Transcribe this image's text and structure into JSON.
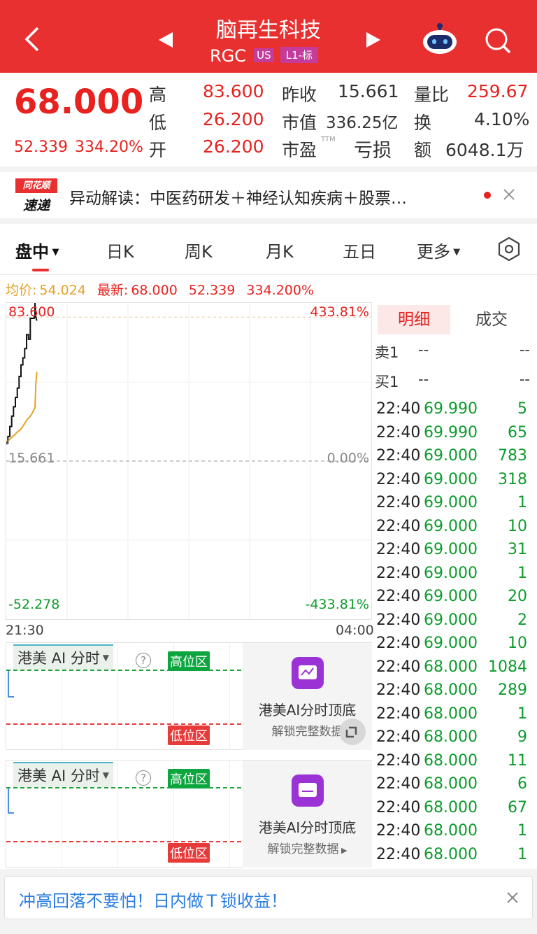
{
  "header": {
    "title": "脑再生科技",
    "ticker": "RGC",
    "market_badge": "US",
    "level_badge": "L1-标"
  },
  "quote": {
    "price": "68.000",
    "change": "52.339",
    "change_pct": "334.20%",
    "fields": [
      {
        "label": "高",
        "value": "83.600",
        "label2": "昨收",
        "value2": "15.661",
        "label3": "量比",
        "value3": "259.67"
      },
      {
        "label": "低",
        "value": "26.200",
        "label2": "市值",
        "value2": "336.25亿",
        "label3": "换",
        "value3": "4.10%"
      },
      {
        "label": "开",
        "value": "26.200",
        "label2": "市盈",
        "value2": "亏损",
        "label3": "额",
        "value3": "6048.1万"
      }
    ],
    "pe_suffix": "TTM"
  },
  "alert": {
    "logo_top": "同花顺",
    "logo_bottom": "速递",
    "text": "异动解读：中医药研发＋神经认知疾病＋股票…"
  },
  "tabs": [
    "盘中",
    "日K",
    "周K",
    "月K",
    "五日",
    "更多"
  ],
  "summary": {
    "avg_label": "均价:",
    "avg_value": "54.024",
    "latest_label": "最新:",
    "latest_value": "68.000",
    "change": "52.339",
    "change_pct": "334.200%"
  },
  "chart": {
    "y_max": "83.600",
    "y_mid": "15.661",
    "y_min": "-52.278",
    "pct_max": "433.81%",
    "pct_mid": "0.00%",
    "pct_min": "-433.81%",
    "t_start": "21:30",
    "t_end": "04:00"
  },
  "chart_data": {
    "type": "line",
    "x_range": [
      "21:30",
      "04:00"
    ],
    "ylim": [
      -52.278,
      83.6
    ],
    "reference": 15.661,
    "series": [
      {
        "name": "最新",
        "color": "#111111",
        "points": [
          [
            0,
            23.5
          ],
          [
            1,
            23.5
          ],
          [
            1,
            26.2
          ],
          [
            3,
            26.2
          ],
          [
            3,
            30.5
          ],
          [
            5,
            30.5
          ],
          [
            5,
            35
          ],
          [
            7,
            35
          ],
          [
            7,
            39
          ],
          [
            9,
            39
          ],
          [
            9,
            43
          ],
          [
            11,
            43
          ],
          [
            11,
            47
          ],
          [
            13,
            47
          ],
          [
            13,
            52
          ],
          [
            15,
            52
          ],
          [
            15,
            57
          ],
          [
            17,
            57
          ],
          [
            17,
            60
          ],
          [
            19,
            60
          ],
          [
            19,
            64
          ],
          [
            21,
            64
          ],
          [
            21,
            70
          ],
          [
            23,
            70
          ],
          [
            23,
            68
          ],
          [
            25,
            68
          ],
          [
            25,
            77
          ],
          [
            29,
            77
          ],
          [
            29,
            77.5
          ],
          [
            30,
            77.5
          ],
          [
            30,
            83.6
          ],
          [
            31,
            77.5
          ],
          [
            32,
            76
          ]
        ]
      },
      {
        "name": "均价",
        "color": "#e5a128",
        "points": [
          [
            0,
            23.5
          ],
          [
            1,
            24
          ],
          [
            2,
            24.6
          ],
          [
            4,
            25.5
          ],
          [
            6,
            26.2
          ],
          [
            8,
            26.8
          ],
          [
            10,
            27.7
          ],
          [
            12,
            28.5
          ],
          [
            14,
            29
          ],
          [
            16,
            30
          ],
          [
            18,
            31.2
          ],
          [
            20,
            32.5
          ],
          [
            22,
            33.7
          ],
          [
            24,
            34.5
          ],
          [
            26,
            35.5
          ],
          [
            28,
            37
          ],
          [
            30,
            38.5
          ],
          [
            31,
            49
          ],
          [
            32,
            54.024
          ]
        ]
      }
    ]
  },
  "detail": {
    "tab_active": "明细",
    "tab_other": "成交",
    "sell": "卖1",
    "buy": "买1",
    "dash": "--",
    "rows": [
      [
        "22:40",
        "69.990",
        "5"
      ],
      [
        "22:40",
        "69.990",
        "65"
      ],
      [
        "22:40",
        "69.000",
        "783"
      ],
      [
        "22:40",
        "69.000",
        "318"
      ],
      [
        "22:40",
        "69.000",
        "1"
      ],
      [
        "22:40",
        "69.000",
        "10"
      ],
      [
        "22:40",
        "69.000",
        "31"
      ],
      [
        "22:40",
        "69.000",
        "1"
      ],
      [
        "22:40",
        "69.000",
        "20"
      ],
      [
        "22:40",
        "69.000",
        "2"
      ],
      [
        "22:40",
        "69.000",
        "10"
      ],
      [
        "22:40",
        "68.000",
        "1084"
      ],
      [
        "22:40",
        "68.000",
        "289"
      ],
      [
        "22:40",
        "68.000",
        "1"
      ],
      [
        "22:40",
        "68.000",
        "9"
      ],
      [
        "22:40",
        "68.000",
        "11"
      ],
      [
        "22:40",
        "68.000",
        "6"
      ],
      [
        "22:40",
        "68.000",
        "67"
      ],
      [
        "22:40",
        "68.000",
        "1"
      ],
      [
        "22:40",
        "68.000",
        "1"
      ]
    ]
  },
  "indicator": {
    "name": "港美 AI 分时",
    "high_zone": "高位区",
    "low_zone": "低位区",
    "promo_title": "港美AI分时顶底",
    "promo_sub": "解锁完整数据",
    "help": "?"
  },
  "bottom": {
    "text": "冲高回落不要怕！日内做Ｔ锁收益！"
  },
  "colors": {
    "header_bg": "#e93030",
    "up": "#e7221f",
    "down": "#0c9b2c",
    "avg": "#e5a128"
  }
}
